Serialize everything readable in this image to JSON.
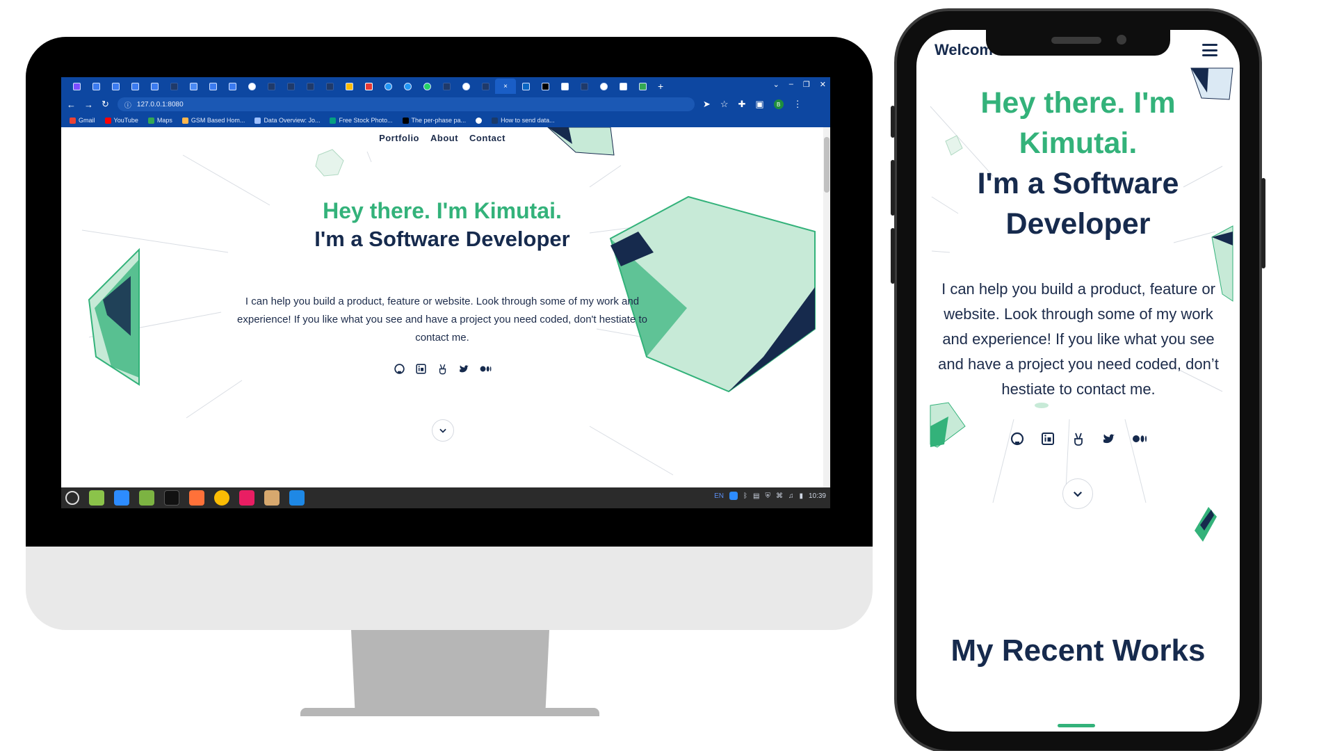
{
  "browser": {
    "tab_favicons": [
      "app-icon",
      "docs-icon",
      "docs-icon",
      "docs-icon",
      "docs-icon",
      "globe-icon",
      "github-icon",
      "zoom-icon",
      "docs-icon",
      "docs-icon",
      "globe-icon",
      "github-icon",
      "github-icon",
      "github-icon",
      "github-icon",
      "drive-icon",
      "youtube-icon",
      "chrome-icon",
      "chrome-icon",
      "whatsapp-icon",
      "github-icon",
      "globe-icon",
      "github-icon"
    ],
    "active_tab_close": "×",
    "new_tab": "+",
    "url": "127.0.0.1:8080",
    "bookmarks": [
      "Gmail",
      "YouTube",
      "Maps",
      "GSM Based Hom...",
      "Data Overview: Jo...",
      "Free Stock Photo...",
      "The per-phase pa...",
      "How to send data..."
    ],
    "profile_initial": "B"
  },
  "desktop_page": {
    "nav": [
      "Portfolio",
      "About",
      "Contact"
    ],
    "greeting": "Hey there. I'm Kimutai.",
    "role": "I'm a Software Developer",
    "description": "I can help you build a product, feature or website. Look through some of my work and experience! If you like what you see and have a project you need coded, don't hestiate to contact me.",
    "socials": [
      "github-icon",
      "linkedin-icon",
      "angellist-icon",
      "twitter-icon",
      "medium-icon"
    ]
  },
  "taskbar": {
    "tray_lang": "EN",
    "clock": "10:39"
  },
  "mobile_page": {
    "welcome": "Welcom",
    "greeting_line1": "Hey there. I'm",
    "greeting_line2": "Kimutai.",
    "role_line1": "I'm a Software",
    "role_line2": "Developer",
    "description": "I can help you build a product, feature or website. Look through some of my work and experience! If you like what you see and have a project you need coded, don’t hestiate to contact me.",
    "section_title": "My Recent Works"
  },
  "colors": {
    "accent_green": "#33b27a",
    "navy": "#162a4d",
    "browser_blue": "#0d47a1"
  }
}
